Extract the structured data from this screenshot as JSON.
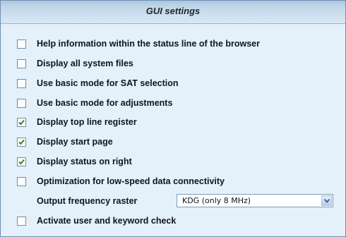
{
  "header": {
    "title": "GUI settings"
  },
  "options": [
    {
      "label": "Help information within the status line of the browser",
      "checked": false
    },
    {
      "label": "Display all system files",
      "checked": false
    },
    {
      "label": "Use basic mode for SAT selection",
      "checked": false
    },
    {
      "label": "Use basic mode for adjustments",
      "checked": false
    },
    {
      "label": "Display top line register",
      "checked": true
    },
    {
      "label": "Display start page",
      "checked": true
    },
    {
      "label": "Display status on right",
      "checked": true
    },
    {
      "label": "Optimization for low-speed data connectivity",
      "checked": false
    }
  ],
  "frequency": {
    "label": "Output frequency raster",
    "value": "KDG (only 8 MHz)"
  },
  "last_option": {
    "label": "Activate user and keyword check",
    "checked": false
  },
  "colors": {
    "panel_bg": "#e4f0fa",
    "check": "#2a8a2a",
    "header_bg": "#c6d9ea"
  },
  "icons": {
    "check": "checkmark-icon",
    "dropdown": "chevron-down-icon"
  }
}
